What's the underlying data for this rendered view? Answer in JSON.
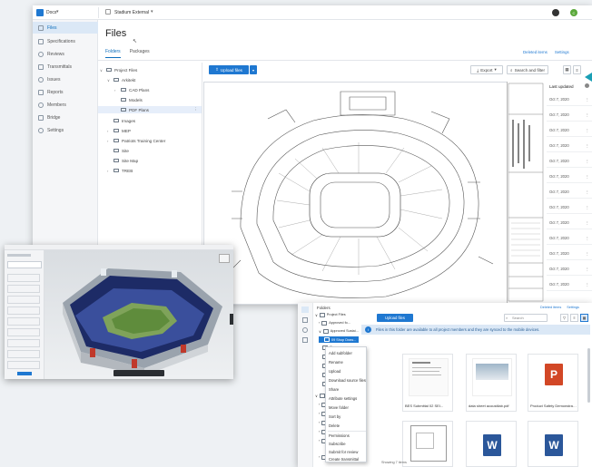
{
  "main": {
    "project_label": "Docs",
    "project_name": "Stadium External",
    "avatar_initial": "C",
    "sidebar": [
      {
        "label": "Files",
        "icon": "folder-icon"
      },
      {
        "label": "Specifications",
        "icon": "doc-icon"
      },
      {
        "label": "Reviews",
        "icon": "check-icon"
      },
      {
        "label": "Transmittals",
        "icon": "send-icon"
      },
      {
        "label": "Issues",
        "icon": "issue-icon"
      },
      {
        "label": "Reports",
        "icon": "report-icon"
      },
      {
        "label": "Members",
        "icon": "members-icon"
      },
      {
        "label": "Bridge",
        "icon": "bridge-icon"
      },
      {
        "label": "Settings",
        "icon": "gear-icon"
      }
    ],
    "page_title": "Files",
    "tabs": [
      "Folders",
      "Packages"
    ],
    "deleted_items": "Deleted items",
    "settings": "Settings",
    "tree": [
      {
        "label": "Project Files",
        "level": 0
      },
      {
        "label": "Arkitekt",
        "level": 1
      },
      {
        "label": "CAD Plans",
        "level": 2
      },
      {
        "label": "Models",
        "level": 2
      },
      {
        "label": "PDF Plans",
        "level": 2
      },
      {
        "label": "Images",
        "level": 1
      },
      {
        "label": "MEP",
        "level": 1
      },
      {
        "label": "Patriots Training Center",
        "level": 1
      },
      {
        "label": "Site",
        "level": 1
      },
      {
        "label": "Site Map",
        "level": 1
      },
      {
        "label": "TREB",
        "level": 1
      }
    ],
    "upload_label": "Upload files",
    "export_label": "Export",
    "search_label": "Search and filter",
    "list_header": "Last updated",
    "list_rows": [
      "Oct 7, 2020",
      "Oct 7, 2020",
      "Oct 7, 2020",
      "Oct 7, 2020",
      "Oct 7, 2020",
      "Oct 7, 2020",
      "Oct 7, 2020",
      "Oct 7, 2020",
      "Oct 7, 2020",
      "Oct 7, 2020",
      "Oct 7, 2020",
      "Oct 7, 2020",
      "Oct 7, 2020"
    ]
  },
  "br": {
    "tree_header": "Folders",
    "tree": [
      "Project Files",
      "Approved fo...",
      "Approved Sustai...",
      "09 Shop Draw...",
      "Cons...",
      "Des...",
      "Gen...",
      "Sub...",
      "Subm...",
      "Proje...",
      "Ar...",
      "Ar...",
      "Bi...",
      "Co...",
      "Co...",
      "Preconstruction"
    ],
    "upload_label": "Upload files",
    "search_placeholder": "Search",
    "deleted_items": "Deleted items",
    "settings": "Settings",
    "banner": "Files in this folder are available to all project members and they are synced to the mobile devices.",
    "context_menu": [
      "Add subfolder",
      "Rename",
      "Upload",
      "Download source files",
      "Share",
      "Attribute settings",
      "Move folder",
      "Sort by",
      "Delete",
      "Permissions",
      "Subscribe",
      "Submit for review",
      "Create transmittal"
    ],
    "cards": [
      {
        "label": "BES Submittal 02 SEI...",
        "type": "doc"
      },
      {
        "label": "data sheet acoustilab.pdf",
        "type": "photo"
      },
      {
        "label": "Product Safety Demonstrati...",
        "type": "ppt"
      },
      {
        "label": "",
        "type": "drawing"
      },
      {
        "label": "",
        "type": "word"
      },
      {
        "label": "",
        "type": "word"
      }
    ],
    "status": "Showing 7 items"
  },
  "colors": {
    "accent": "#1f78d1",
    "powerpoint": "#d24726",
    "word": "#2b579a"
  }
}
